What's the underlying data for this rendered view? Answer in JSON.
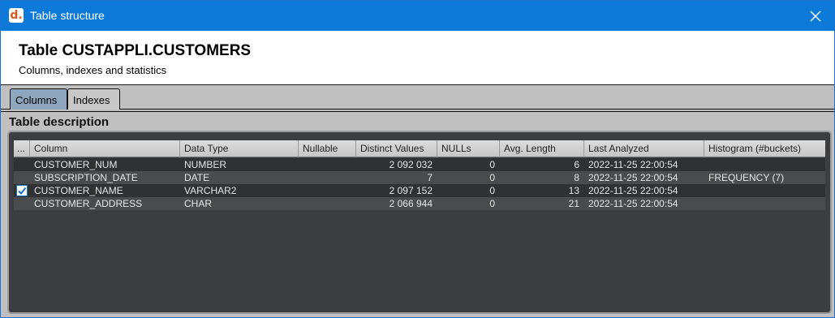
{
  "window": {
    "title": "Table structure",
    "app_icon_glyph": "d."
  },
  "header": {
    "title": "Table CUSTAPPLI.CUSTOMERS",
    "subtitle": "Columns, indexes and statistics"
  },
  "tabs": [
    {
      "label": "Columns",
      "active": true
    },
    {
      "label": "Indexes",
      "active": false
    }
  ],
  "section_title": "Table description",
  "table": {
    "headers": [
      "...",
      "Column",
      "Data Type",
      "Nullable",
      "Distinct Values",
      "NULLs",
      "Avg. Length",
      "Last Analyzed",
      "Histogram (#buckets)"
    ],
    "rows": [
      {
        "checked": false,
        "column": "CUSTOMER_NUM",
        "data_type": "NUMBER",
        "nullable": "",
        "distinct": "2 092 032",
        "nulls": "0",
        "avg_length": "6",
        "last_analyzed": "2022-11-25 22:00:54",
        "histogram": ""
      },
      {
        "checked": false,
        "column": "SUBSCRIPTION_DATE",
        "data_type": "DATE",
        "nullable": "",
        "distinct": "7",
        "nulls": "0",
        "avg_length": "8",
        "last_analyzed": "2022-11-25 22:00:54",
        "histogram": "FREQUENCY (7)"
      },
      {
        "checked": true,
        "column": "CUSTOMER_NAME",
        "data_type": "VARCHAR2",
        "nullable": "",
        "distinct": "2 097 152",
        "nulls": "0",
        "avg_length": "13",
        "last_analyzed": "2022-11-25 22:00:54",
        "histogram": ""
      },
      {
        "checked": false,
        "column": "CUSTOMER_ADDRESS",
        "data_type": "CHAR",
        "nullable": "",
        "distinct": "2 066 944",
        "nulls": "0",
        "avg_length": "21",
        "last_analyzed": "2022-11-25 22:00:54",
        "histogram": ""
      }
    ]
  },
  "colors": {
    "titlebar": "#0d7ad9",
    "active_tab": "#8ea6be",
    "grid_background": "#3c3d3f",
    "row_odd": "#2f3133",
    "row_even": "#4a4b4d",
    "checkbox_accent": "#1e73c9"
  },
  "icons": {
    "app": "dbvis-app-icon",
    "close": "close-icon",
    "checkbox": "checkmark-icon"
  }
}
